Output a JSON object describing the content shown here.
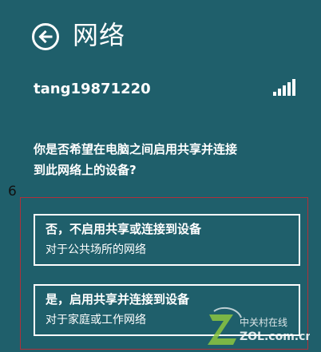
{
  "header": {
    "title": "网络",
    "back_icon": "arrow-left-icon"
  },
  "network": {
    "ssid": "tang19871220",
    "signal_icon": "signal-strength-icon",
    "signal_level": 1.0
  },
  "prompt": {
    "question_line1": "你是否希望在电脑之间启用共享并连接",
    "question_line2": "到此网络上的设备?"
  },
  "options": [
    {
      "title": "否，不启用共享或连接到设备",
      "description": "对于公共场所的网络"
    },
    {
      "title": "是，启用共享并连接到设备",
      "description": "对于家庭或工作网络"
    }
  ],
  "annotation": {
    "number": "6",
    "color": "#b0303a"
  },
  "watermark": {
    "cn_text": "中关村在线",
    "en_text": "ZOL.com.cn"
  },
  "colors": {
    "background": "#1f5f6b",
    "foreground": "#ffffff",
    "watermark_green": "#8cc63f"
  }
}
